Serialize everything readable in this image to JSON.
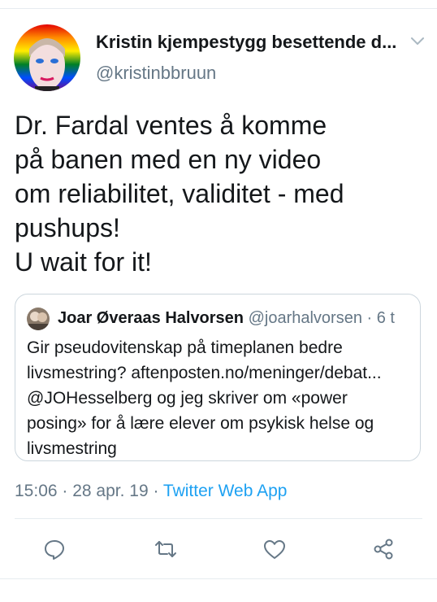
{
  "tweet": {
    "display_name": "Kristin kjempestygg besettende d...",
    "handle": "@kristinbbruun",
    "text_lines": [
      "Dr. Fardal ventes å komme",
      "på banen med en ny video",
      "om reliabilitet, validitet - med",
      "pushups!",
      "U wait for it!"
    ],
    "timestamp": "15:06 · 28 apr. 19 · ",
    "source": "Twitter Web App"
  },
  "quote": {
    "name": "Joar Øveraas Halvorsen",
    "meta": " @joarhalvorsen · 6 t",
    "text_lines": [
      "Gir pseudovitenskap på timeplanen bedre",
      "livsmestring? aftenposten.no/meninger/debat...",
      "@JOHesselberg og jeg skriver om «power",
      "posing» for å lære elever om psykisk helse og",
      "livsmestring"
    ]
  },
  "icons": {
    "caret": "chevron-down-icon",
    "reply": "reply-icon",
    "retweet": "retweet-icon",
    "like": "heart-icon",
    "share": "share-icon"
  },
  "colors": {
    "text": "#14171a",
    "secondary": "#657786",
    "link": "#1da1f2",
    "divider": "#e6ecf0"
  }
}
